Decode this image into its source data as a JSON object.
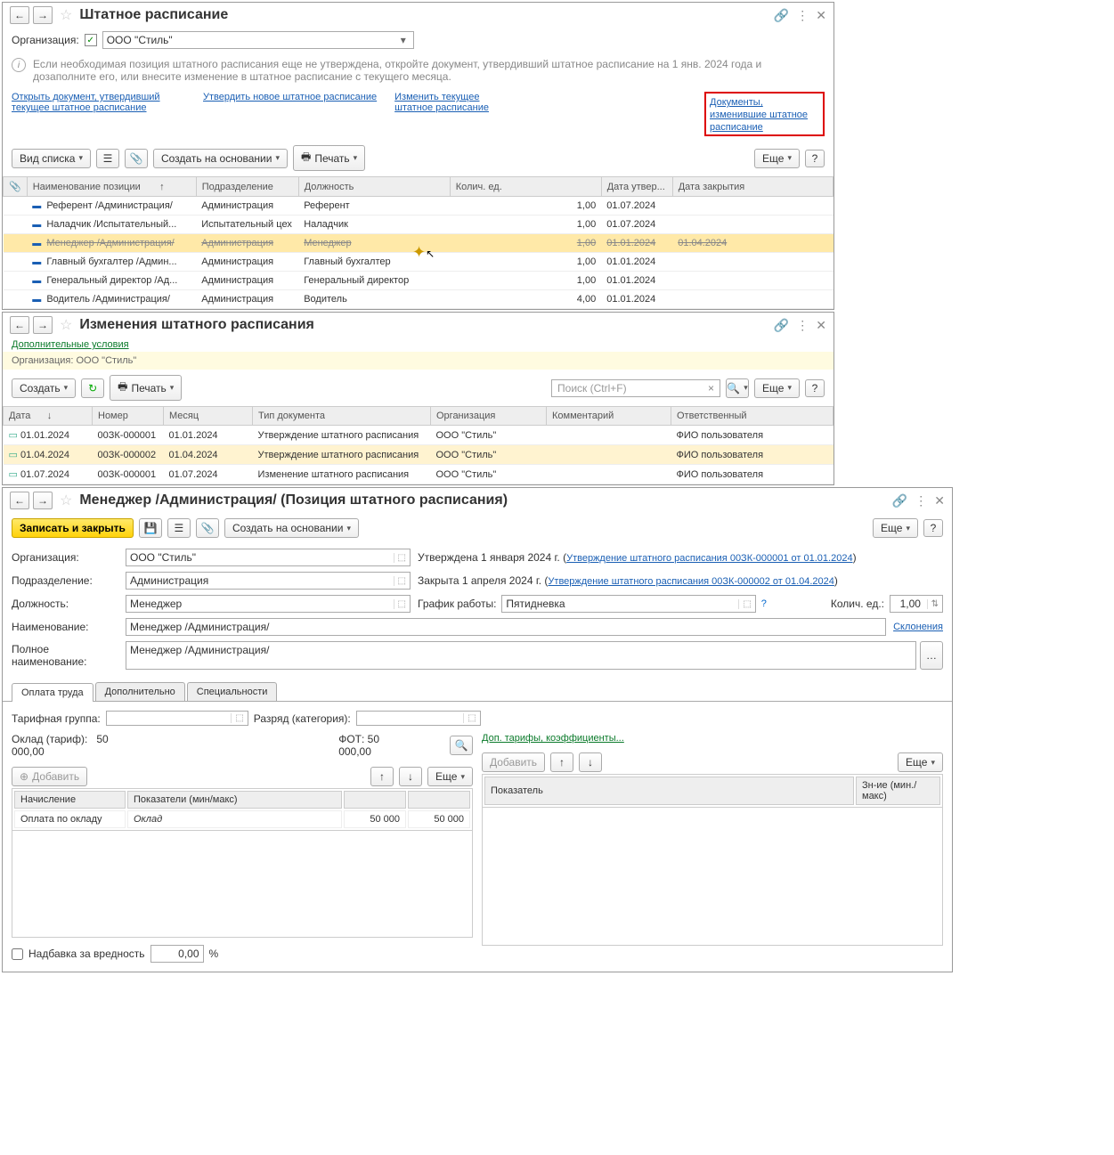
{
  "panel1": {
    "title": "Штатное расписание",
    "org_label": "Организация:",
    "org_value": "ООО \"Стиль\"",
    "info": "Если необходимая позиция штатного расписания еще не утверждена, откройте документ, утвердивший штатное расписание на 1 янв. 2024 года и дозаполните его, или внесите изменение в штатное расписание с текущего месяца.",
    "links": {
      "l1": "Открыть документ, утвердивший текущее штатное расписание",
      "l2": "Утвердить новое штатное расписание",
      "l3": "Изменить текущее штатное расписание",
      "l4": "Документы, изменившие штатное расписание"
    },
    "toolbar": {
      "view": "Вид списка",
      "create": "Создать на основании",
      "print": "Печать",
      "more": "Еще"
    },
    "cols": {
      "name": "Наименование позиции",
      "dept": "Подразделение",
      "job": "Должность",
      "qty": "Колич. ед.",
      "appr": "Дата утвер...",
      "close": "Дата закрытия"
    },
    "rows": [
      {
        "name": "Референт /Администрация/",
        "dept": "Администрация",
        "job": "Референт",
        "qty": "1,00",
        "appr": "01.07.2024",
        "close": ""
      },
      {
        "name": "Наладчик /Испытательный...",
        "dept": "Испытательный цех",
        "job": "Наладчик",
        "qty": "1,00",
        "appr": "01.07.2024",
        "close": ""
      },
      {
        "name": "Менеджер /Администрация/",
        "dept": "Администрация",
        "job": "Менеджер",
        "qty": "1,00",
        "appr": "01.01.2024",
        "close": "01.04.2024",
        "selected": true,
        "strike": true
      },
      {
        "name": "Главный бухгалтер /Админ...",
        "dept": "Администрация",
        "job": "Главный бухгалтер",
        "qty": "1,00",
        "appr": "01.01.2024",
        "close": ""
      },
      {
        "name": "Генеральный директор /Ад...",
        "dept": "Администрация",
        "job": "Генеральный директор",
        "qty": "1,00",
        "appr": "01.01.2024",
        "close": ""
      },
      {
        "name": "Водитель /Администрация/",
        "dept": "Администрация",
        "job": "Водитель",
        "qty": "4,00",
        "appr": "01.01.2024",
        "close": ""
      }
    ]
  },
  "panel2": {
    "title": "Изменения штатного расписания",
    "extra": "Дополнительные условия",
    "org": "Организация: ООО \"Стиль\"",
    "toolbar": {
      "create": "Создать",
      "print": "Печать",
      "search_ph": "Поиск (Ctrl+F)",
      "more": "Еще"
    },
    "cols": {
      "date": "Дата",
      "num": "Номер",
      "month": "Месяц",
      "type": "Тип документа",
      "org": "Организация",
      "comm": "Комментарий",
      "resp": "Ответственный"
    },
    "rows": [
      {
        "date": "01.01.2024",
        "num": "00ЗК-000001",
        "month": "01.01.2024",
        "type": "Утверждение штатного расписания",
        "org": "ООО \"Стиль\"",
        "resp": "ФИО пользователя"
      },
      {
        "date": "01.04.2024",
        "num": "00ЗК-000002",
        "month": "01.04.2024",
        "type": "Утверждение штатного расписания",
        "org": "ООО \"Стиль\"",
        "resp": "ФИО пользователя",
        "selected": true
      },
      {
        "date": "01.07.2024",
        "num": "00ЗК-000001",
        "month": "01.07.2024",
        "type": "Изменение штатного расписания",
        "org": "ООО \"Стиль\"",
        "resp": "ФИО пользователя"
      }
    ]
  },
  "panel3": {
    "title": "Менеджер /Администрация/ (Позиция штатного расписания)",
    "toolbar": {
      "save": "Записать и закрыть",
      "create": "Создать на основании",
      "more": "Еще"
    },
    "fields": {
      "org_l": "Организация:",
      "org_v": "ООО \"Стиль\"",
      "appr_text": "Утверждена 1 января 2024 г. (",
      "appr_link": "Утверждение штатного расписания 00ЗК-000001 от 01.01.2024",
      "dept_l": "Подразделение:",
      "dept_v": "Администрация",
      "close_text": "Закрыта 1 апреля 2024 г. (",
      "close_link": "Утверждение штатного расписания 00ЗК-000002 от 01.04.2024",
      "job_l": "Должность:",
      "job_v": "Менеджер",
      "sched_l": "График работы:",
      "sched_v": "Пятидневка",
      "qty_l": "Колич. ед.:",
      "qty_v": "1,00",
      "name_l": "Наименование:",
      "name_v": "Менеджер /Администрация/",
      "decl": "Склонения",
      "full_l": "Полное наименование:",
      "full_v": "Менеджер /Администрация/"
    },
    "tabs": {
      "t1": "Оплата труда",
      "t2": "Дополнительно",
      "t3": "Специальности"
    },
    "pay": {
      "tariff_l": "Тарифная группа:",
      "rank_l": "Разряд (категория):",
      "salary_l": "Оклад (тариф):",
      "salary_v": "50 000,00",
      "fot_l": "ФОТ:",
      "fot_v": "50 000,00",
      "add": "Добавить",
      "more": "Еще",
      "col1": "Начисление",
      "col2": "Показатели (мин/макс)",
      "r1_c1": "Оплата по окладу",
      "r1_c2": "Оклад",
      "r1_min": "50 000",
      "r1_max": "50 000",
      "extra_link": "Доп. тарифы, коэффициенты...",
      "add2": "Добавить",
      "col3": "Показатель",
      "col4": "Зн-ие (мин./макс)",
      "hazard_l": "Надбавка за вредность",
      "hazard_v": "0,00",
      "pct": "%"
    }
  }
}
